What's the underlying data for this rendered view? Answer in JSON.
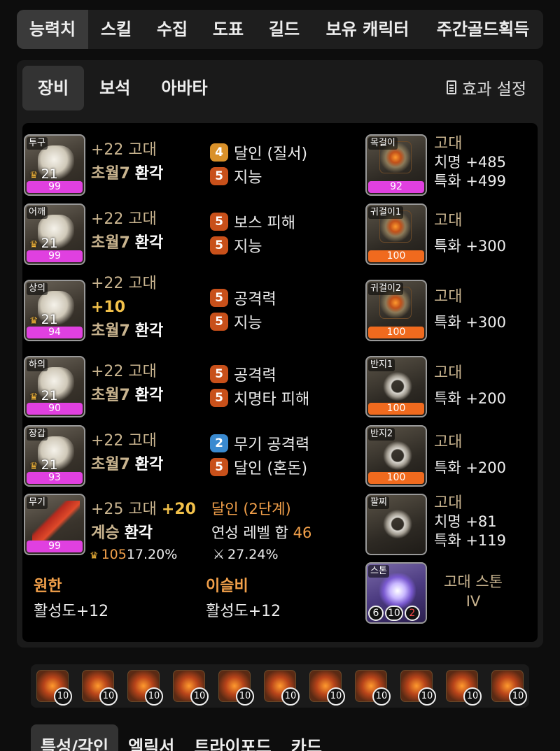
{
  "top_tabs": [
    "능력치",
    "스킬",
    "수집",
    "도표",
    "길드",
    "보유 캐릭터",
    "주간골드획득"
  ],
  "sub_tabs": [
    "장비",
    "보석",
    "아바타"
  ],
  "effect_setting_label": "효과 설정",
  "armor": [
    {
      "slot": "투구",
      "level": "21",
      "quality": "99",
      "line1": "+22 고대",
      "line2_a": "초월7",
      "line2_b": "환각",
      "stats": [
        {
          "badge": "4",
          "color": "gold",
          "name": "달인 (질서)"
        },
        {
          "badge": "5",
          "color": "orange",
          "name": "지능"
        }
      ]
    },
    {
      "slot": "어깨",
      "level": "21",
      "quality": "99",
      "line1": "+22 고대",
      "line2_a": "초월7",
      "line2_b": "환각",
      "stats": [
        {
          "badge": "5",
          "color": "orange",
          "name": "보스 피해"
        },
        {
          "badge": "5",
          "color": "orange",
          "name": "지능"
        }
      ]
    },
    {
      "slot": "상의",
      "level": "21",
      "quality": "94",
      "line1": "+22 고대",
      "line1b": "+10",
      "line2_a": "초월7",
      "line2_b": "환각",
      "stats": [
        {
          "badge": "5",
          "color": "orange",
          "name": "공격력"
        },
        {
          "badge": "5",
          "color": "orange",
          "name": "지능"
        }
      ]
    },
    {
      "slot": "하의",
      "level": "21",
      "quality": "90",
      "line1": "+22 고대",
      "line2_a": "초월7",
      "line2_b": "환각",
      "stats": [
        {
          "badge": "5",
          "color": "orange",
          "name": "공격력"
        },
        {
          "badge": "5",
          "color": "orange",
          "name": "치명타 피해"
        }
      ]
    },
    {
      "slot": "장갑",
      "level": "21",
      "quality": "93",
      "line1": "+22 고대",
      "line2_a": "초월7",
      "line2_b": "환각",
      "stats": [
        {
          "badge": "2",
          "color": "blue",
          "name": "무기 공격력"
        },
        {
          "badge": "5",
          "color": "orange",
          "name": "달인 (혼돈)"
        }
      ]
    }
  ],
  "weapon": {
    "slot": "무기",
    "quality": "99",
    "line1": "+25 고대",
    "line1b": "+20",
    "line2_a": "계승",
    "line2_b": "환각",
    "flame_value": "105",
    "percent1": "17.20%",
    "bracelet_title": "달인 (2단계)",
    "refine_label": "연성 레벨 합",
    "refine_value": "46",
    "percent2": "27.24%"
  },
  "accessories": [
    {
      "slot": "목걸이",
      "quality": "92",
      "bar": "pink",
      "grade": "고대",
      "lines": [
        "치명 +485",
        "특화 +499"
      ]
    },
    {
      "slot": "귀걸이1",
      "quality": "100",
      "bar": "orange",
      "grade": "고대",
      "lines": [
        "특화 +300"
      ]
    },
    {
      "slot": "귀걸이2",
      "quality": "100",
      "bar": "orange",
      "grade": "고대",
      "lines": [
        "특화 +300"
      ]
    },
    {
      "slot": "반지1",
      "quality": "100",
      "bar": "orange",
      "grade": "고대",
      "lines": [
        "특화 +200"
      ]
    },
    {
      "slot": "반지2",
      "quality": "100",
      "bar": "orange",
      "grade": "고대",
      "lines": [
        "특화 +200"
      ]
    },
    {
      "slot": "팔찌",
      "grade": "고대",
      "lines": [
        "치명 +81",
        "특화 +119"
      ]
    }
  ],
  "stone": {
    "slot": "스톤",
    "name": "고대 스톤",
    "tier": "IV",
    "engrave": [
      "6",
      "10",
      "2"
    ]
  },
  "bottom_effects": [
    {
      "title": "원한",
      "value": "활성도+12"
    },
    {
      "title": "이슬비",
      "value": "활성도+12"
    }
  ],
  "gems": [
    "10",
    "10",
    "10",
    "10",
    "10",
    "10",
    "10",
    "10",
    "10",
    "10",
    "10"
  ],
  "bottom_tabs": [
    "특성/각인",
    "엘릭서",
    "트라이포드",
    "카드"
  ],
  "colors": {
    "quality_pink": "#e040e0",
    "quality_orange": "#f06a1e",
    "grade_tan": "#c9b48f",
    "title_orange": "#f2a04a"
  }
}
